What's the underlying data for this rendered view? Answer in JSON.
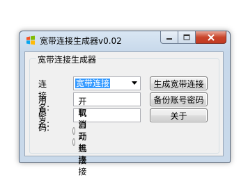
{
  "window": {
    "title": "宽带连接生成器v0.02"
  },
  "group": {
    "label": "宽带连接生成器"
  },
  "form": {
    "connection_label": "连接名:",
    "connection_value": "宽带连接",
    "username_label": "用户名:",
    "username_value": "",
    "password_label": "密　码:",
    "password_value": ""
  },
  "buttons": {
    "create": "生成宽带连接",
    "backup": "备份账号密码",
    "about": "关于"
  },
  "radios": {
    "auto_connect": "开机自动连接",
    "cancel_auto_connect": "取消开机连接"
  },
  "colors": {
    "selection": "#3399ff",
    "close_button": "#c9462b",
    "titlebar": "#d9e6f3"
  }
}
